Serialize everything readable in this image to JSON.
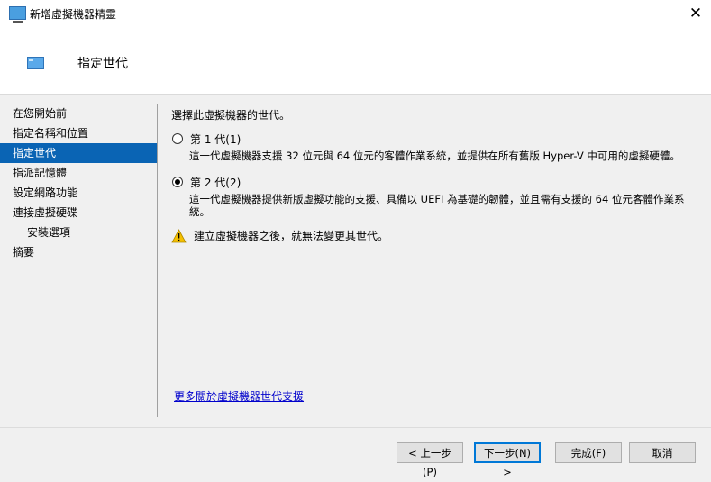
{
  "window": {
    "title": "新增虛擬機器精靈",
    "close_icon": "close-icon"
  },
  "header": {
    "title": "指定世代"
  },
  "nav": {
    "items": [
      {
        "label": "在您開始前",
        "selected": false,
        "sub": false
      },
      {
        "label": "指定名稱和位置",
        "selected": false,
        "sub": false
      },
      {
        "label": "指定世代",
        "selected": true,
        "sub": false
      },
      {
        "label": "指派記憶體",
        "selected": false,
        "sub": false
      },
      {
        "label": "設定網路功能",
        "selected": false,
        "sub": false
      },
      {
        "label": "連接虛擬硬碟",
        "selected": false,
        "sub": false
      },
      {
        "label": "安裝選項",
        "selected": false,
        "sub": true
      },
      {
        "label": "摘要",
        "selected": false,
        "sub": false
      }
    ]
  },
  "content": {
    "prompt": "選擇此虛擬機器的世代。",
    "options": [
      {
        "label": "第 1 代(1)",
        "checked": false,
        "description": "這一代虛擬機器支援 32 位元與 64 位元的客體作業系統，並提供在所有舊版 Hyper-V 中可用的虛擬硬體。"
      },
      {
        "label": "第 2 代(2)",
        "checked": true,
        "description": "這一代虛擬機器提供新版虛擬功能的支援、具備以 UEFI 為基礎的韌體，並且需有支援的 64 位元客體作業系統。"
      }
    ],
    "warning": "建立虛擬機器之後，就無法變更其世代。",
    "more_link": "更多關於虛擬機器世代支援"
  },
  "buttons": {
    "previous": "< 上一步(P)",
    "next": "下一步(N) >",
    "finish": "完成(F)",
    "cancel": "取消"
  },
  "colors": {
    "nav_selected": "#0a64b4",
    "link": "#0000cc",
    "accent": "#0078d7"
  }
}
